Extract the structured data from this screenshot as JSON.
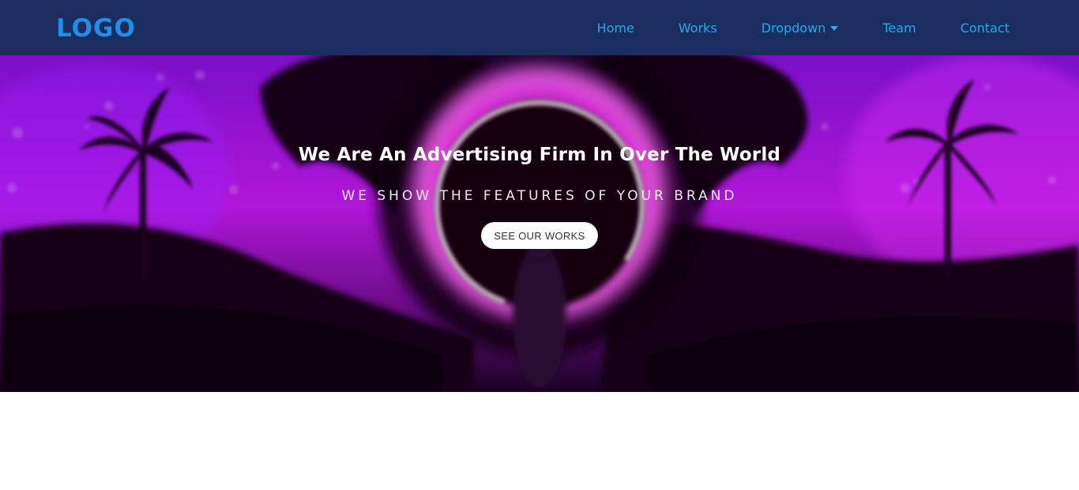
{
  "header": {
    "logo": "LOGO",
    "nav": [
      {
        "label": "Home"
      },
      {
        "label": "Works"
      },
      {
        "label": "Dropdown"
      },
      {
        "label": "Team"
      },
      {
        "label": "Contact"
      }
    ]
  },
  "hero": {
    "title": "We Are An Advertising Firm In Over The World",
    "subtitle": "WE SHOW THE FEATURES OF YOUR BRAND",
    "button_label": "SEE OUR WORKS"
  },
  "colors": {
    "nav_background": "#1b2d5e",
    "logo": "#1f8fe8",
    "nav_link": "#2aa7e8",
    "hero_accent": "#d415e0"
  }
}
